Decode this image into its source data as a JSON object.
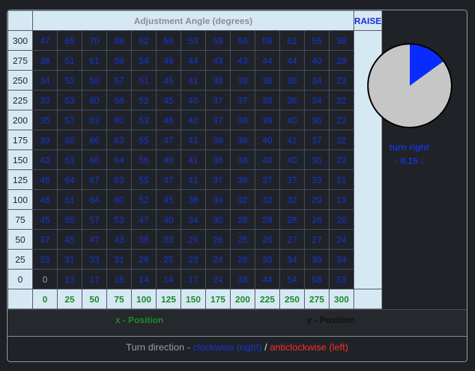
{
  "header": {
    "title": "Adjustment Angle (degrees)",
    "side_title": "RAISE"
  },
  "grid": {
    "y_labels": [
      "300",
      "275",
      "250",
      "225",
      "200",
      "175",
      "150",
      "125",
      "100",
      "75",
      "50",
      "25",
      "0"
    ],
    "x_labels": [
      "0",
      "25",
      "50",
      "75",
      "100",
      "125",
      "150",
      "175",
      "200",
      "225",
      "250",
      "275",
      "300"
    ],
    "rows": [
      [
        "47",
        "65",
        "70",
        "68",
        "62",
        "56",
        "53",
        "53",
        "56",
        "59",
        "61",
        "56",
        "39"
      ],
      [
        "38",
        "51",
        "61",
        "59",
        "54",
        "49",
        "44",
        "43",
        "43",
        "44",
        "44",
        "40",
        "28"
      ],
      [
        "34",
        "52",
        "58",
        "57",
        "51",
        "45",
        "41",
        "38",
        "38",
        "38",
        "38",
        "34",
        "23"
      ],
      [
        "33",
        "53",
        "60",
        "58",
        "52",
        "45",
        "40",
        "37",
        "37",
        "38",
        "38",
        "34",
        "22"
      ],
      [
        "35",
        "57",
        "63",
        "60",
        "53",
        "46",
        "40",
        "37",
        "38",
        "39",
        "40",
        "36",
        "22"
      ],
      [
        "39",
        "60",
        "66",
        "63",
        "55",
        "47",
        "41",
        "38",
        "38",
        "40",
        "41",
        "37",
        "22"
      ],
      [
        "43",
        "63",
        "68",
        "64",
        "56",
        "48",
        "41",
        "38",
        "38",
        "40",
        "40",
        "36",
        "22"
      ],
      [
        "46",
        "64",
        "67",
        "63",
        "55",
        "47",
        "41",
        "37",
        "36",
        "37",
        "37",
        "33",
        "21"
      ],
      [
        "48",
        "61",
        "64",
        "60",
        "52",
        "45",
        "38",
        "34",
        "32",
        "32",
        "32",
        "29",
        "19"
      ],
      [
        "45",
        "55",
        "57",
        "53",
        "47",
        "40",
        "34",
        "30",
        "28",
        "28",
        "28",
        "26",
        "20"
      ],
      [
        "37",
        "45",
        "47",
        "43",
        "38",
        "33",
        "29",
        "26",
        "25",
        "26",
        "27",
        "27",
        "24"
      ],
      [
        "23",
        "31",
        "33",
        "31",
        "28",
        "25",
        "23",
        "24",
        "26",
        "30",
        "34",
        "36",
        "34"
      ],
      [
        "0",
        "13",
        "17",
        "16",
        "14",
        "14",
        "17",
        "24",
        "33",
        "44",
        "54",
        "58",
        "53"
      ]
    ]
  },
  "indicator": {
    "fraction": 0.15,
    "fill_color": "#0a2bff",
    "base_color": "#c6c6c6",
    "direction": "turn right",
    "value_text": "↑ 0.15 ↓"
  },
  "axes": {
    "x_title": "x - Position",
    "y_title": "y - Position"
  },
  "legend": {
    "prefix": "Turn direction - ",
    "clockwise": "clockwise (right)",
    "separator": " / ",
    "anticlockwise": "anticlockwise (left)"
  }
}
